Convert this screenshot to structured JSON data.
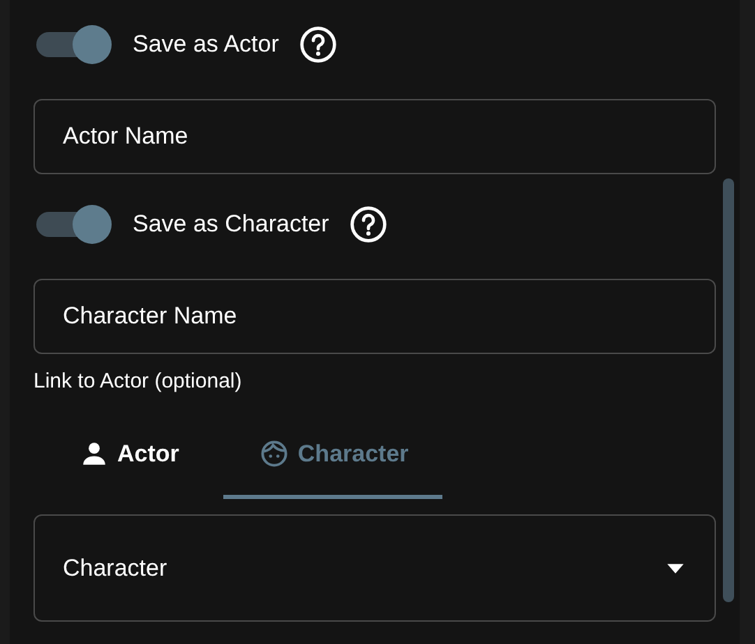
{
  "sections": [
    {
      "toggle": {
        "label": "Save as Actor",
        "on": true
      },
      "field": {
        "placeholder": "Actor Name"
      }
    },
    {
      "toggle": {
        "label": "Save as Character",
        "on": true
      },
      "field": {
        "placeholder": "Character Name"
      }
    }
  ],
  "link_label": "Link to Actor (optional)",
  "tabs": [
    {
      "label": "Actor",
      "kind": "person",
      "selected": false
    },
    {
      "label": "Character",
      "kind": "face",
      "selected": true
    }
  ],
  "select": {
    "value": "Character"
  }
}
